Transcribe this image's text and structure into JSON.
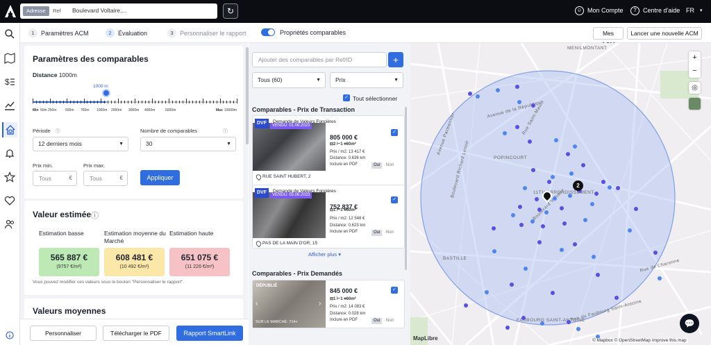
{
  "topbar": {
    "search_tab_address": "Adresse",
    "search_tab_ref": "Ref",
    "search_value": "Boulevard Voltaire,...",
    "account_label": "Mon Compte",
    "help_label": "Centre d'aide",
    "language": "FR"
  },
  "steps": [
    {
      "num": "1",
      "label": "Paramètres ACM"
    },
    {
      "num": "2",
      "label": "Évaluation"
    },
    {
      "num": "3",
      "label": "Personnaliser le rapport"
    }
  ],
  "toggle_label": "Propriétés comparables",
  "my_acm_button": "Mes ACM",
  "new_acm_button": "Lancer une nouvelle ACM",
  "params": {
    "title": "Paramètres des comparables",
    "distance_label": "Distance",
    "distance_value": "1000m",
    "slider_marker": "1000 m",
    "slider_fraction": 0.36,
    "ticks": [
      "Min",
      "50m",
      "250m",
      "500m",
      "750m",
      "1000m",
      "2000m",
      "3000m",
      "4000m",
      "5000m",
      "Max",
      "10000m"
    ],
    "period_label": "Période",
    "period_value": "12 derniers mois",
    "count_label": "Nombre de comparables",
    "count_value": "30",
    "price_min_label": "Prix min.",
    "price_min_placeholder": "Tous",
    "price_max_label": "Prix max.",
    "price_max_placeholder": "Tous",
    "currency": "€",
    "apply_button": "Appliquer"
  },
  "estimate": {
    "title": "Valeur estimée",
    "low_label": "Estimation basse",
    "mid_label": "Estimation moyenne du Marché",
    "high_label": "Estimation haute",
    "low_value": "565 887 €",
    "low_sqm": "(9757 €/m²)",
    "mid_value": "608 481 €",
    "mid_sqm": "(10 492 €/m²)",
    "high_value": "651 075 €",
    "high_sqm": "(11 226 €/m²)",
    "note": "Vous pouvez modifier ces valeurs sous le bouton \"Personnaliser le rapport\"."
  },
  "averages_title": "Valeurs moyennes",
  "bottom_buttons": {
    "customize": "Personnaliser",
    "download": "Télécharger le PDF",
    "smartlink": "Rapport SmartLink"
  },
  "comparables": {
    "add_placeholder": "Ajouter des comparables par Ref/ID",
    "filter_value": "Tous (60)",
    "sort_value": "Prix",
    "select_all": "Tout sélectionner",
    "section_transactions": "Comparables - Prix de Transaction",
    "section_asked": "Comparables - Prix Demandés",
    "show_more": "Afficher plus",
    "items": [
      {
        "badge": "DVF",
        "source": "Demande de Valeurs Foncières",
        "sold": "VENDU: 01.06.2023",
        "price": "805 000 €",
        "rooms": "2",
        "beds": "1",
        "area": "60m²",
        "price_sqm": "Prix / m2: 13 417 €",
        "distance": "Distance: 0.636 km",
        "include_pdf": "Inclure en PDF",
        "yes": "Oui",
        "no": "Non",
        "address": "RUE SAINT HUBERT, 2"
      },
      {
        "badge": "DVF",
        "source": "Demande de Valeurs Foncières",
        "sold": "VENDU: 05.06.2023",
        "price": "752 837 €",
        "rooms": "1",
        "beds": "1",
        "area": "60m²",
        "price_sqm": "Prix / m2: 12 548 €",
        "distance": "Distance: 0.623 km",
        "include_pdf": "Inclure en PDF",
        "yes": "Oui",
        "no": "Non",
        "address": "PAS DE LA MAIN D'OR, 15"
      },
      {
        "source_tag": "DÉPUBLIÉ",
        "photo_caption": "SUR LE MARCHÉ: 714+",
        "price": "845 000 €",
        "rooms": "1",
        "beds": "1",
        "area": "60m²",
        "price_sqm": "Prix / m2: 14 083 €",
        "distance": "Distance: 0.028 km",
        "include_pdf": "Inclure en PDF",
        "yes": "Oui",
        "no": "Non"
      }
    ]
  },
  "map": {
    "labels": [
      "MENILMONTANT",
      "Avenue de la République",
      "POPINCOURT",
      "11TH ARRONDISSEMENT",
      "Boulevard Voltaire",
      "Rue de Charonne",
      "Boulevard Richard Lenoir",
      "BASTILLE",
      "FAUBOURG SAINT-ANTOINE",
      "Rue du Faubourg Saint-Antoine",
      "Avenue Parmentier",
      "Rue Saint-Maur"
    ],
    "cluster_count": "2",
    "maplibre": "MapLibre",
    "attribution": "© Mapbox © OpenStreetMap  Improve this map",
    "colors": {
      "dot_purple": "#5a4fe0",
      "dot_blue": "#4d86ef",
      "radius_fill": "#a9bff0"
    }
  }
}
